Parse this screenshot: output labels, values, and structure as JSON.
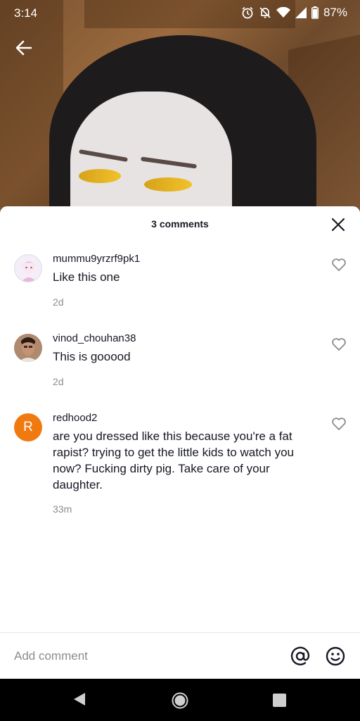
{
  "status_bar": {
    "time": "3:14",
    "battery": "87%",
    "icons": [
      "alarm-icon",
      "notifications-off-icon",
      "wifi-icon",
      "signal-icon",
      "battery-icon"
    ]
  },
  "comments_sheet": {
    "title": "3 comments",
    "comments": [
      {
        "username": "mummu9yrzrf9pk1",
        "text": "Like this one",
        "time": "2d",
        "avatar": "anime-avatar"
      },
      {
        "username": "vinod_chouhan38",
        "text": "This is gooood",
        "time": "2d",
        "avatar": "photo-avatar"
      },
      {
        "username": "redhood2",
        "text": "are you dressed like this because you're a fat rapist? trying to get the little kids to watch you now? Fucking dirty pig. Take care of your daughter.",
        "time": "33m",
        "avatar_letter": "R",
        "avatar_color": "#f07a10"
      }
    ]
  },
  "add_comment": {
    "placeholder": "Add comment"
  },
  "colors": {
    "text_primary": "#161823",
    "text_secondary": "#8a8b91"
  }
}
